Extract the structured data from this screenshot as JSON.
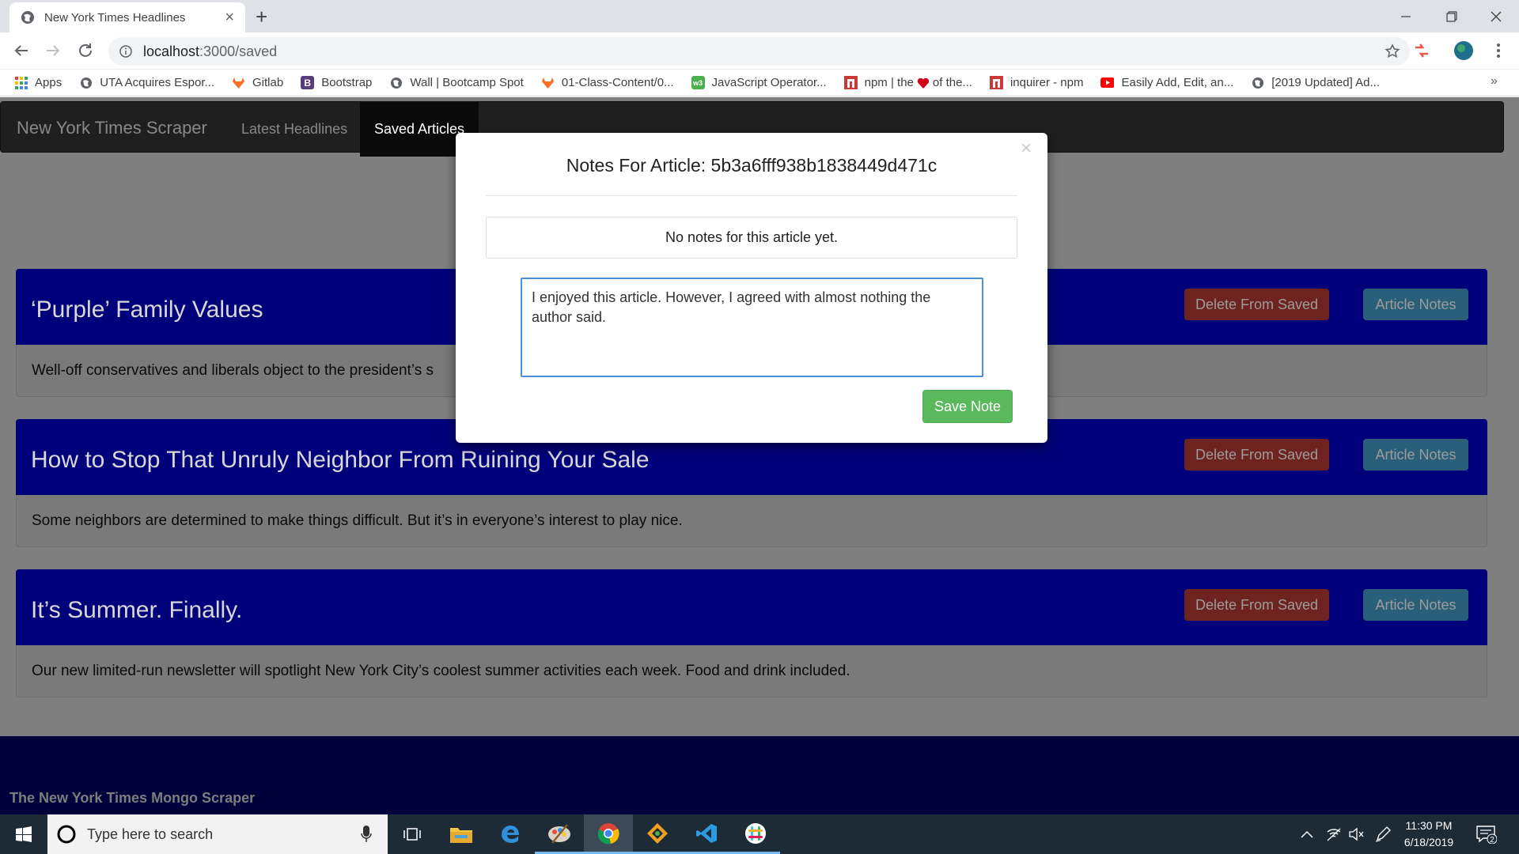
{
  "browser": {
    "tab_title": "New York Times Headlines",
    "tab_close": "×",
    "new_tab": "+",
    "url_host": "localhost",
    "url_path": ":3000/saved",
    "bookmarks": [
      {
        "label": "Apps",
        "icon": "apps-grid-icon"
      },
      {
        "label": "UTA Acquires Espor...",
        "icon": "globe-icon"
      },
      {
        "label": "Gitlab",
        "icon": "gitlab-icon"
      },
      {
        "label": "Bootstrap",
        "icon": "bootstrap-icon"
      },
      {
        "label": "Wall | Bootcamp Spot",
        "icon": "globe-icon"
      },
      {
        "label": "01-Class-Content/0...",
        "icon": "gitlab-icon"
      },
      {
        "label": "JavaScript Operator...",
        "icon": "w3-icon"
      },
      {
        "label": "npm | the",
        "label_suffix": "of the...",
        "icon": "npm-icon"
      },
      {
        "label": "inquirer - npm",
        "icon": "npm-icon"
      },
      {
        "label": "Easily Add, Edit, an...",
        "icon": "youtube-icon"
      },
      {
        "label": "[2019 Updated] Ad...",
        "icon": "globe-icon"
      }
    ],
    "bookmarks_overflow": "»"
  },
  "app": {
    "brand": "New York Times Scraper",
    "nav": [
      {
        "label": "Latest Headlines",
        "active": false
      },
      {
        "label": "Saved Articles",
        "active": true
      }
    ],
    "articles": [
      {
        "title": "‘Purple’ Family Values",
        "summary": "Well-off conservatives and liberals object to the president’s s",
        "delete_label": "Delete From Saved",
        "notes_label": "Article Notes"
      },
      {
        "title": "How to Stop That Unruly Neighbor From Ruining Your Sale",
        "summary": "Some neighbors are determined to make things difficult. But it’s in everyone’s interest to play nice.",
        "delete_label": "Delete From Saved",
        "notes_label": "Article Notes"
      },
      {
        "title": "It’s Summer. Finally.",
        "summary": "Our new limited-run newsletter will spotlight New York City’s coolest summer activities each week. Food and drink included.",
        "delete_label": "Delete From Saved",
        "notes_label": "Article Notes"
      }
    ],
    "footer_text": "The New York Times Mongo Scraper"
  },
  "modal": {
    "close": "×",
    "title": "Notes For Article: 5b3a6fff938b1838449d471c",
    "empty_notes": "No notes for this article yet.",
    "note_value": "I enjoyed this article. However, I agreed with almost nothing the author said.",
    "save_label": "Save Note"
  },
  "taskbar": {
    "search_placeholder": "Type here to search",
    "time": "11:30 PM",
    "date": "6/18/2019",
    "notification_count": "2"
  },
  "colors": {
    "card_header": "#00007a",
    "footer": "#00003b",
    "save_button": "#5cb85c",
    "delete_button": "#6f2321",
    "notes_button": "#2a5f7a"
  }
}
